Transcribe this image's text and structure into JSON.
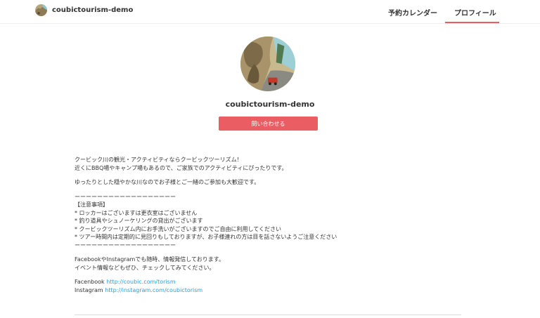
{
  "header": {
    "brand_name": "coubictourism-demo",
    "nav": [
      {
        "label": "予約カレンダー",
        "active": false
      },
      {
        "label": "プロフィール",
        "active": true
      }
    ],
    "active_color": "#ea5d62"
  },
  "profile": {
    "name": "coubictourism-demo",
    "contact_button": "問い合わせる",
    "button_color": "#ea5d62"
  },
  "description": {
    "line1": "クービック川の観光・アクティビティならクービックツーリズム！",
    "line2": "近くにBBQ場やキャンプ場もあるので、ご家族でのアクティビティにぴったりです。",
    "line3": "ゆったりとした穏やかな川なのでお子様とご一緒のご参加も大歓迎です。",
    "separator1": "ーーーーーーーーーーーーーーーーーー",
    "notes_heading": "【注意事項】",
    "note1": "* ロッカーはございますは更衣室はございません",
    "note2": "* 釣り道具やシュノーケリングの貸出がございます",
    "note3": "* クービックツーリズム内にお手洗いがございますのでご自由に利用してください",
    "note4": "* ツアー時間内は定期的に見回りもしておりますが、お子様連れの方は目を話さないようご注意ください",
    "separator2": "ーーーーーーーーーーーーーーーーーー",
    "social_line1": "FacebookやInstagramでも随時、情報発信しております。",
    "social_line2": "イベント情報などもぜひ、チェックしてみてください。",
    "facebook_label": "Facenbook",
    "facebook_url": "http://coubic.com/torism",
    "instagram_label": "Instagram",
    "instagram_url": "http://instagram.com/coubictorism",
    "link_color": "#2a9fd6"
  }
}
